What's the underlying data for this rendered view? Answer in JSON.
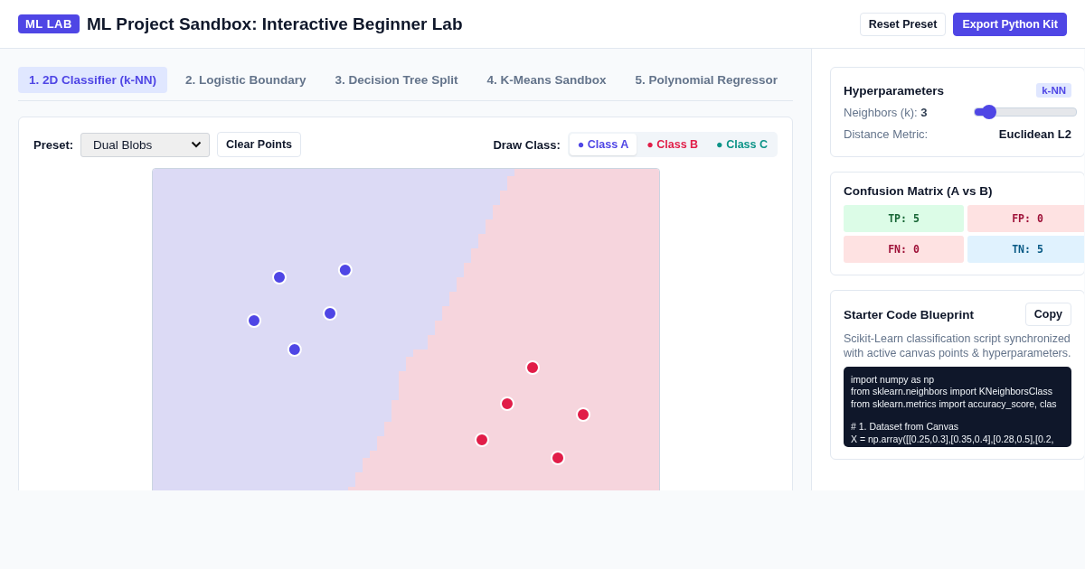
{
  "header": {
    "badge": "ML LAB",
    "title": "ML Project Sandbox: Interactive Beginner Lab",
    "buttons": [
      {
        "label": "Reset Preset",
        "kind": "secondary"
      },
      {
        "label": "Export Python Kit",
        "kind": "primary"
      }
    ]
  },
  "tabs": [
    {
      "label": "1. 2D Classifier (k-NN)",
      "selected": true
    },
    {
      "label": "2. Logistic Boundary",
      "selected": false
    },
    {
      "label": "3. Decision Tree Split",
      "selected": false
    },
    {
      "label": "4. K-Means Sandbox",
      "selected": false
    },
    {
      "label": "5. Polynomial Regressor",
      "selected": false
    }
  ],
  "toolbar": {
    "preset_label": "Preset:",
    "preset_value": "Dual Blobs",
    "clear_button": "Clear Points",
    "draw_label": "Draw Class:",
    "classes": [
      {
        "label": "● Class A",
        "color": "#4f46e5",
        "selected": true
      },
      {
        "label": "● Class B",
        "color": "#e11d48",
        "selected": false
      },
      {
        "label": "● Class C",
        "color": "#0d9488",
        "selected": false
      }
    ]
  },
  "hyperparameters": {
    "title": "Hyperparameters",
    "badge": "k-NN",
    "neighbors_label": "Neighbors (k):",
    "neighbors_value": "3",
    "level": 0.14,
    "metric_label": "Distance Metric:",
    "metric_value": "Euclidean L2"
  },
  "confusion_matrix": {
    "title": "Confusion Matrix (A vs B)",
    "cells": [
      {
        "label": "TP: 5",
        "kind": "good"
      },
      {
        "label": "FP: 0",
        "kind": "bad"
      },
      {
        "label": "FN: 0",
        "kind": "bad"
      },
      {
        "label": "TN: 5",
        "kind": "neutral"
      }
    ]
  },
  "code": {
    "title": "Starter Code Blueprint",
    "copy": "Copy",
    "description": "Scikit-Learn classification script synchronized with active canvas points & hyperparameters.",
    "blocks": [
      [
        "import numpy as np",
        "from sklearn.neighbors import KNeighborsClass",
        "from sklearn.metrics import accuracy_score, clas"
      ],
      [
        "# 1. Dataset from Canvas",
        "X = np.array([[0.25,0.3],[0.35,0.4],[0.28,0.5],[0.2,"
      ]
    ]
  }
}
